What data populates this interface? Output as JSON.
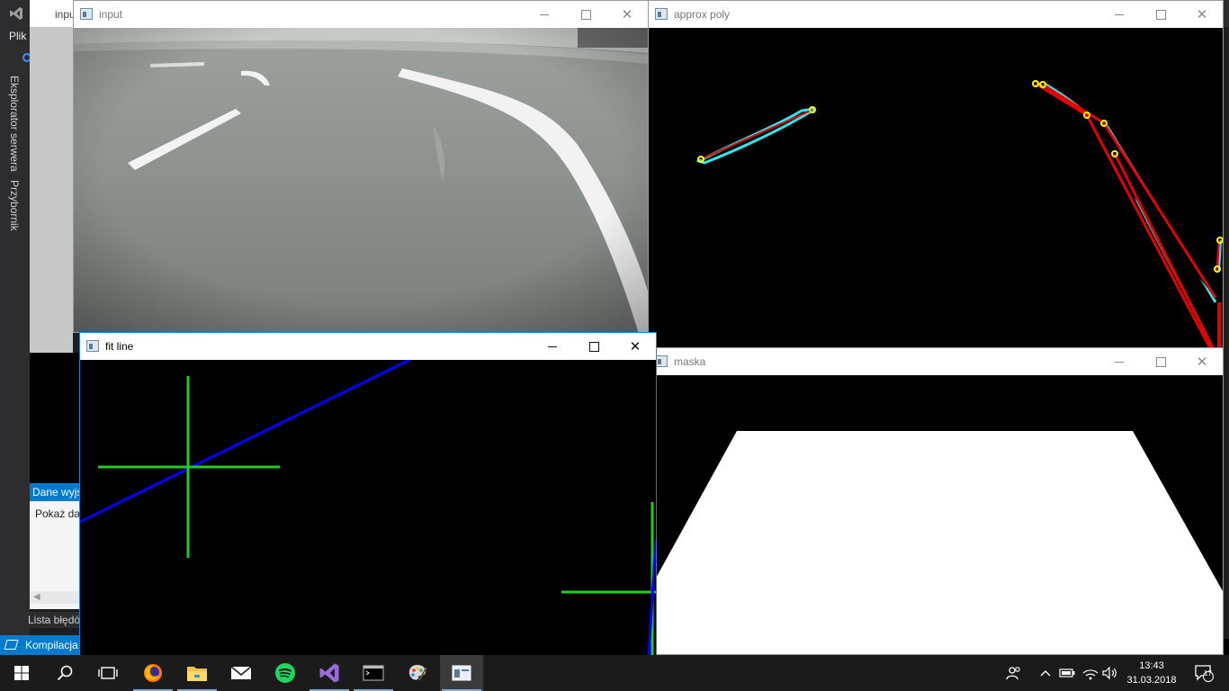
{
  "vs": {
    "menu_plik": "Plik",
    "tab_server_explorer": "Eksplorator serwera",
    "tab_toolbox": "Przybornik",
    "output_header": "Dane wyjściowe",
    "output_show_label": "Pokaż dane wyjściowe z:",
    "errors_tab": "Lista błędów",
    "status_text": "Kompilacja",
    "bg_window_title": "input"
  },
  "windows": {
    "input": {
      "title": "input"
    },
    "approx": {
      "title": "approx poly"
    },
    "fitline": {
      "title": "fit line"
    },
    "maska": {
      "title": "maska"
    }
  },
  "taskbar": {
    "time": "13:43",
    "date": "31.03.2018",
    "notification_count": "17",
    "apps": [
      "start-button",
      "search-button",
      "task-view-button",
      "firefox",
      "file-explorer",
      "mail",
      "spotify",
      "visual-studio",
      "console",
      "paint",
      "opencv-window"
    ]
  },
  "colors": {
    "vs_accent": "#007acc",
    "window_active_border": "#1883d7",
    "fit_line_blue": "#0000ff",
    "fit_cross_green": "#22cc22",
    "contour_cyan": "#33e6f2",
    "poly_red": "#e60000",
    "vertex_yellow": "#ffff00"
  }
}
